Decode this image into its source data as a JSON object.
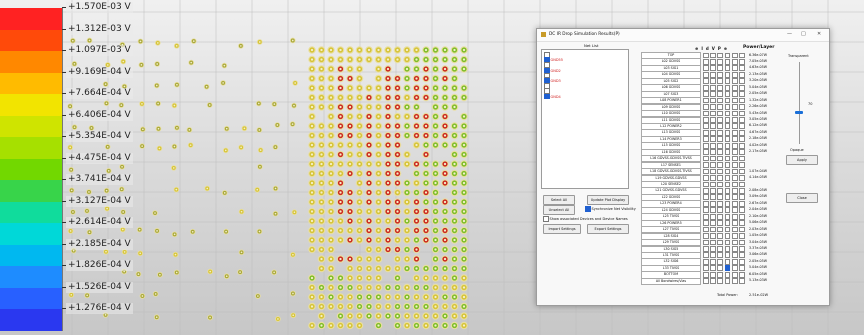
{
  "legend": {
    "labels": [
      "+1.570E-03 V",
      "+1.312E-03 V",
      "+1.097E-03 V",
      "+9.169E-04 V",
      "+7.664E-04 V",
      "+6.406E-04 V",
      "+5.354E-04 V",
      "+4.475E-04 V",
      "+3.741E-04 V",
      "+3.127E-04 V",
      "+2.614E-04 V",
      "+2.185E-04 V",
      "+1.826E-04 V",
      "+1.526E-04 V",
      "+1.276E-04 V"
    ],
    "colors": [
      "#ff2222",
      "#ff4a0a",
      "#ff8800",
      "#ffbb00",
      "#f2e400",
      "#cfe400",
      "#a6e000",
      "#72d800",
      "#38d44a",
      "#10dc9c",
      "#00d8d8",
      "#00b8f0",
      "#1e8cff",
      "#2860ff",
      "#2a38f0"
    ]
  },
  "plot": {
    "pad_colors": {
      "olive": "#a8a83c",
      "yellow": "#d6c438",
      "green": "#7fbe2a",
      "red": "#cc2a22",
      "ring": "#e9dfa0"
    }
  },
  "dialog": {
    "title": "DC IR Drop Simulation Results(P)",
    "minimize_icon": "minimize-icon",
    "maximize_icon": "maximize-icon",
    "close_icon": "close-icon",
    "net_list_label": "Net List",
    "net_items": [
      {
        "label": "",
        "state": "dim",
        "checked": false
      },
      {
        "label": "GND55",
        "state": "red",
        "checked": true
      },
      {
        "label": "",
        "state": "dim",
        "checked": false
      },
      {
        "label": "GND2",
        "state": "red",
        "checked": true
      },
      {
        "label": "",
        "state": "dim",
        "checked": false
      },
      {
        "label": "GND3",
        "state": "red",
        "checked": true
      },
      {
        "label": "",
        "state": "dim",
        "checked": false
      },
      {
        "label": "",
        "state": "dim",
        "checked": false
      },
      {
        "label": "GND4",
        "state": "red",
        "checked": true
      }
    ],
    "select_all": "Select All",
    "unselect_all": "Unselect All",
    "update_plot": "Update Plot Display",
    "sync_net": "Synchronize Net Visibility",
    "show_assoc": "Show associated Devices and Device Names",
    "import_settings": "Import Settings",
    "export_settings": "Export Settings",
    "column_icons": [
      "⊕",
      "I",
      "d",
      "V",
      "P",
      "⊕"
    ],
    "power_layer_header": "Power/Layer",
    "layers": [
      {
        "name": "TOP",
        "power": "6.36e-07W",
        "checks": [
          0,
          0,
          0,
          0,
          0,
          0
        ]
      },
      {
        "name": "L02 GDVSS",
        "power": "7.05e-05W",
        "checks": [
          0,
          0,
          0,
          0,
          0,
          0
        ]
      },
      {
        "name": "L03 SIG1",
        "power": "4.63e-05W",
        "checks": [
          0,
          0,
          0,
          0,
          0,
          0
        ]
      },
      {
        "name": "L04 GDVSS",
        "power": "2.13e-05W",
        "checks": [
          0,
          0,
          0,
          0,
          0,
          0
        ]
      },
      {
        "name": "L05 SIG2",
        "power": "3.20e-05W",
        "checks": [
          0,
          0,
          0,
          0,
          0,
          0
        ]
      },
      {
        "name": "L06 GDVSS",
        "power": "5.04e-05W",
        "checks": [
          0,
          0,
          0,
          0,
          0,
          0
        ]
      },
      {
        "name": "L07 SIG3",
        "power": "2.05e-05W",
        "checks": [
          0,
          0,
          0,
          0,
          0,
          0
        ]
      },
      {
        "name": "L08 POWER1",
        "power": "1.32e-05W",
        "checks": [
          0,
          0,
          0,
          0,
          0,
          0
        ]
      },
      {
        "name": "L09 GDVSS",
        "power": "2.26e-05W",
        "checks": [
          0,
          0,
          0,
          0,
          0,
          0
        ]
      },
      {
        "name": "L10 GDVSS",
        "power": "5.43e-05W",
        "checks": [
          0,
          0,
          0,
          0,
          0,
          0
        ]
      },
      {
        "name": "L11 GDVSS",
        "power": "3.05e-05W",
        "checks": [
          0,
          0,
          0,
          0,
          0,
          0
        ]
      },
      {
        "name": "L12 POWER2",
        "power": "6.12e-05W",
        "checks": [
          0,
          0,
          0,
          0,
          0,
          0
        ]
      },
      {
        "name": "L13 GDVSS",
        "power": "4.67e-05W",
        "checks": [
          0,
          0,
          0,
          0,
          0,
          0
        ]
      },
      {
        "name": "L14 POWER3",
        "power": "2.18e-05W",
        "checks": [
          0,
          0,
          0,
          0,
          0,
          0
        ]
      },
      {
        "name": "L15 GDVSS",
        "power": "4.02e-05W",
        "checks": [
          0,
          0,
          0,
          0,
          0,
          0
        ]
      },
      {
        "name": "L16 GDVSS",
        "power": "2.17e-05W",
        "checks": [
          0,
          0,
          0,
          0,
          0,
          0
        ]
      },
      {
        "name": "L16 GDVSS.GDVSS.TIVSS",
        "power": "",
        "checks": [
          0,
          0,
          0,
          0,
          0,
          0
        ]
      },
      {
        "name": "L17 SENSE1",
        "power": "",
        "checks": [
          0,
          0,
          0,
          0,
          0,
          0
        ]
      },
      {
        "name": "L18 GDVSS.GDVSS.TIVSS",
        "power": "1.07e-04W",
        "checks": [
          0,
          0,
          0,
          0,
          0,
          0
        ]
      },
      {
        "name": "L19 GDVSS.GDVSS",
        "power": "4.14e-05W",
        "checks": [
          0,
          0,
          0,
          0,
          0,
          0
        ]
      },
      {
        "name": "L20 SENSE2",
        "power": "",
        "checks": [
          0,
          0,
          0,
          0,
          0,
          0
        ]
      },
      {
        "name": "L21 GDVSS.GDVSS",
        "power": "2.08e-05W",
        "checks": [
          0,
          0,
          0,
          0,
          0,
          0
        ]
      },
      {
        "name": "L22 GDVSS",
        "power": "3.09e-05W",
        "checks": [
          0,
          0,
          0,
          0,
          0,
          0
        ]
      },
      {
        "name": "L23 POWER4",
        "power": "2.67e-05W",
        "checks": [
          0,
          0,
          0,
          0,
          0,
          0
        ]
      },
      {
        "name": "L24 GDVSS",
        "power": "2.04e-05W",
        "checks": [
          0,
          0,
          0,
          0,
          0,
          0
        ]
      },
      {
        "name": "L25 TIVSS",
        "power": "2.10e-05W",
        "checks": [
          0,
          0,
          0,
          0,
          0,
          0
        ]
      },
      {
        "name": "L26 POWER5",
        "power": "5.06e-05W",
        "checks": [
          0,
          0,
          0,
          0,
          0,
          0
        ]
      },
      {
        "name": "L27 TIVSS",
        "power": "2.03e-05W",
        "checks": [
          0,
          0,
          0,
          0,
          0,
          0
        ]
      },
      {
        "name": "L28 SIG4",
        "power": "1.05e-05W",
        "checks": [
          0,
          0,
          0,
          0,
          0,
          0
        ]
      },
      {
        "name": "L29 TIVSS",
        "power": "3.04e-05W",
        "checks": [
          0,
          0,
          0,
          0,
          0,
          0
        ]
      },
      {
        "name": "L30 SIG5",
        "power": "3.37e-05W",
        "checks": [
          0,
          0,
          0,
          0,
          0,
          0
        ]
      },
      {
        "name": "L31 TIVSS",
        "power": "3.06e-05W",
        "checks": [
          0,
          0,
          0,
          0,
          0,
          0
        ]
      },
      {
        "name": "L32 SIG6",
        "power": "2.05e-05W",
        "checks": [
          0,
          0,
          0,
          0,
          0,
          0
        ]
      },
      {
        "name": "L33 TIVSS",
        "power": "5.04e-05W",
        "checks": [
          0,
          0,
          0,
          1,
          0,
          0
        ]
      },
      {
        "name": "BOTTOM",
        "power": "6.05e-05W",
        "checks": [
          0,
          0,
          0,
          0,
          0,
          0
        ]
      },
      {
        "name": "All Bondwires/Vias",
        "power": "5.13e-03W",
        "checks": [
          0,
          0,
          0,
          0,
          0,
          0
        ]
      }
    ],
    "total_power_label": "Total Power:",
    "total_power_value": "2.51e-02W",
    "transparent_label": "Transparent",
    "opaque_label": "Opaque",
    "slider_value": "70",
    "transparency_fraction": 0.62,
    "apply": "Apply",
    "close": "Close"
  }
}
